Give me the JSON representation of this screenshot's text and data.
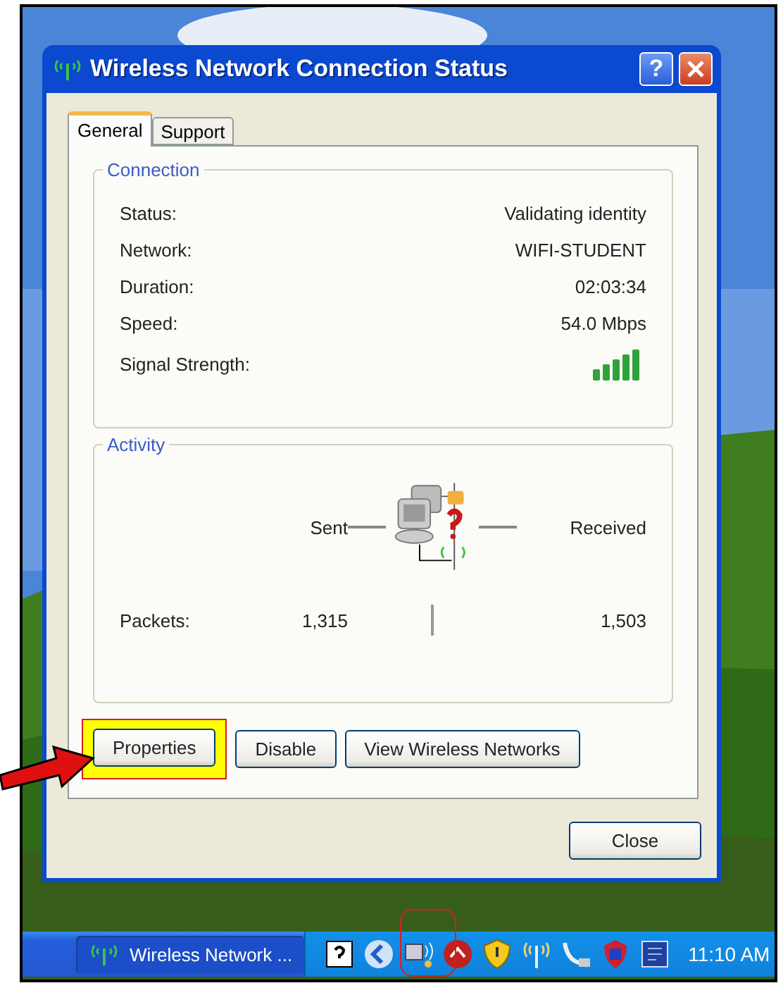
{
  "window": {
    "title": "Wireless Network Connection Status",
    "help_button": "?"
  },
  "tabs": [
    {
      "label": "General",
      "selected": true
    },
    {
      "label": "Support",
      "selected": false
    }
  ],
  "connection": {
    "title": "Connection",
    "rows": [
      {
        "kind": "text",
        "label": "Status:",
        "value": "Validating identity"
      },
      {
        "kind": "text",
        "label": "Network:",
        "value": "WIFI-STUDENT"
      },
      {
        "kind": "text",
        "label": "Duration:",
        "value": "02:03:34"
      },
      {
        "kind": "text",
        "label": "Speed:",
        "value": "54.0 Mbps"
      },
      {
        "kind": "signal",
        "label": "Signal Strength:"
      }
    ]
  },
  "activity": {
    "title": "Activity",
    "sent_label": "Sent",
    "received_label": "Received",
    "packets_label": "Packets:",
    "packets_sent": "1,315",
    "packets_received": "1,503"
  },
  "buttons": [
    {
      "label": "Properties",
      "highlighted": true
    },
    {
      "label": "Disable",
      "highlighted": false
    },
    {
      "label": "View Wireless Networks",
      "highlighted": false
    }
  ],
  "close_button": "Close",
  "taskbar": {
    "task": "Wireless Network ...",
    "clock": "11:10 AM"
  }
}
